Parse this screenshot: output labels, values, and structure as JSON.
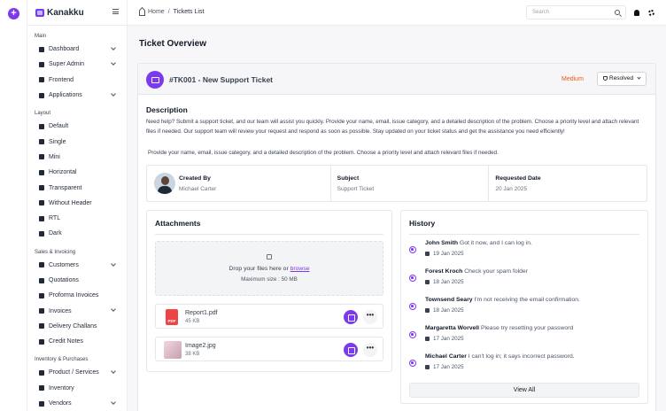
{
  "rail": {
    "add_label": "+"
  },
  "brand": {
    "name": "Kanakku"
  },
  "sidebar": {
    "sections": [
      {
        "title": "Main",
        "items": [
          {
            "label": "Dashboard",
            "icon": "dashboard-icon",
            "chevron": true
          },
          {
            "label": "Super Admin",
            "icon": "super-admin-icon",
            "chevron": true
          },
          {
            "label": "Frontend",
            "icon": "frontend-icon",
            "chevron": false
          },
          {
            "label": "Applications",
            "icon": "applications-icon",
            "chevron": true
          }
        ]
      },
      {
        "title": "Layout",
        "items": [
          {
            "label": "Default",
            "icon": "layout-default-icon",
            "chevron": false
          },
          {
            "label": "Single",
            "icon": "layout-single-icon",
            "chevron": false
          },
          {
            "label": "Mini",
            "icon": "layout-mini-icon",
            "chevron": false
          },
          {
            "label": "Horizontal",
            "icon": "layout-horizontal-icon",
            "chevron": false
          },
          {
            "label": "Transparent",
            "icon": "layout-transparent-icon",
            "chevron": false
          },
          {
            "label": "Without Header",
            "icon": "layout-without-header-icon",
            "chevron": false
          },
          {
            "label": "RTL",
            "icon": "layout-rtl-icon",
            "chevron": false
          },
          {
            "label": "Dark",
            "icon": "dark-mode-icon",
            "chevron": false
          }
        ]
      },
      {
        "title": "Sales & Invoicing",
        "items": [
          {
            "label": "Customers",
            "icon": "customers-icon",
            "chevron": true
          },
          {
            "label": "Quotations",
            "icon": "quotations-icon",
            "chevron": false
          },
          {
            "label": "Proforma Invoices",
            "icon": "proforma-invoices-icon",
            "chevron": false
          },
          {
            "label": "Invoices",
            "icon": "invoices-icon",
            "chevron": true
          },
          {
            "label": "Delivery Challans",
            "icon": "delivery-challans-icon",
            "chevron": false
          },
          {
            "label": "Credit Notes",
            "icon": "credit-notes-icon",
            "chevron": false
          }
        ]
      },
      {
        "title": "Inventory & Purchases",
        "items": [
          {
            "label": "Product / Services",
            "icon": "product-services-icon",
            "chevron": true
          },
          {
            "label": "Inventory",
            "icon": "inventory-icon",
            "chevron": false
          },
          {
            "label": "Vendors",
            "icon": "vendors-icon",
            "chevron": true
          }
        ]
      }
    ]
  },
  "topbar": {
    "breadcrumb": {
      "home": "Home",
      "separator": "/",
      "current": "Tickets List"
    },
    "search_placeholder": "Search"
  },
  "page": {
    "title": "Ticket Overview"
  },
  "ticket": {
    "id": "#TK001 -",
    "title": "New Support Ticket",
    "priority": "Medium",
    "status": "Resolved",
    "colors": {
      "accent": "#7c3aed",
      "priority": "#ea580c"
    }
  },
  "description": {
    "heading": "Description",
    "paragraph": "Need help? Submit a support ticket, and our team will assist you quickly. Provide your name, email, issue category, and a detailed description of the problem. Choose a priority level and attach relevant files if needed. Our support team will review your request and respond as soon as possible. Stay updated on your ticket status and get the assistance you need efficiently!",
    "paragraph2": "Provide your name, email, issue category, and a detailed description of the problem. Choose a priority level and attach relevant files if needed."
  },
  "meta": {
    "created_by_label": "Created By",
    "created_by_value": "Michael Carter",
    "subject_label": "Subject",
    "subject_value": "Support Ticket",
    "requested_label": "Requested Date",
    "requested_value": "20 Jan 2025"
  },
  "attachments": {
    "heading": "Attachments",
    "drop_text": "Drop your files here or",
    "browse": "browse",
    "max_size": "Maximum size : 50 MB",
    "files": [
      {
        "name": "Report1.pdf",
        "size": "45 KB",
        "icon": "pdf-icon",
        "icon_text": "PDF"
      },
      {
        "name": "Image2.jpg",
        "size": "38 KB",
        "icon": "image-thumbnail-icon"
      }
    ],
    "more_label": "•••"
  },
  "history": {
    "heading": "History",
    "entries": [
      {
        "name": "John Smith",
        "message": "Got it now, and I can log in.",
        "date": "19 Jan 2025"
      },
      {
        "name": "Forest Kroch",
        "message": "Check your spam folder",
        "date": "18 Jan 2025"
      },
      {
        "name": "Townsend Seary",
        "message": "I'm not receiving the email confirmation.",
        "date": "18 Jan 2025"
      },
      {
        "name": "Margaretta Worvell",
        "message": "Please try resetting your password",
        "date": "17 Jan 2025"
      },
      {
        "name": "Michael Carter",
        "message": "I can't log in; it says incorrect password.",
        "date": "17 Jan 2025"
      }
    ],
    "view_all": "View All"
  }
}
